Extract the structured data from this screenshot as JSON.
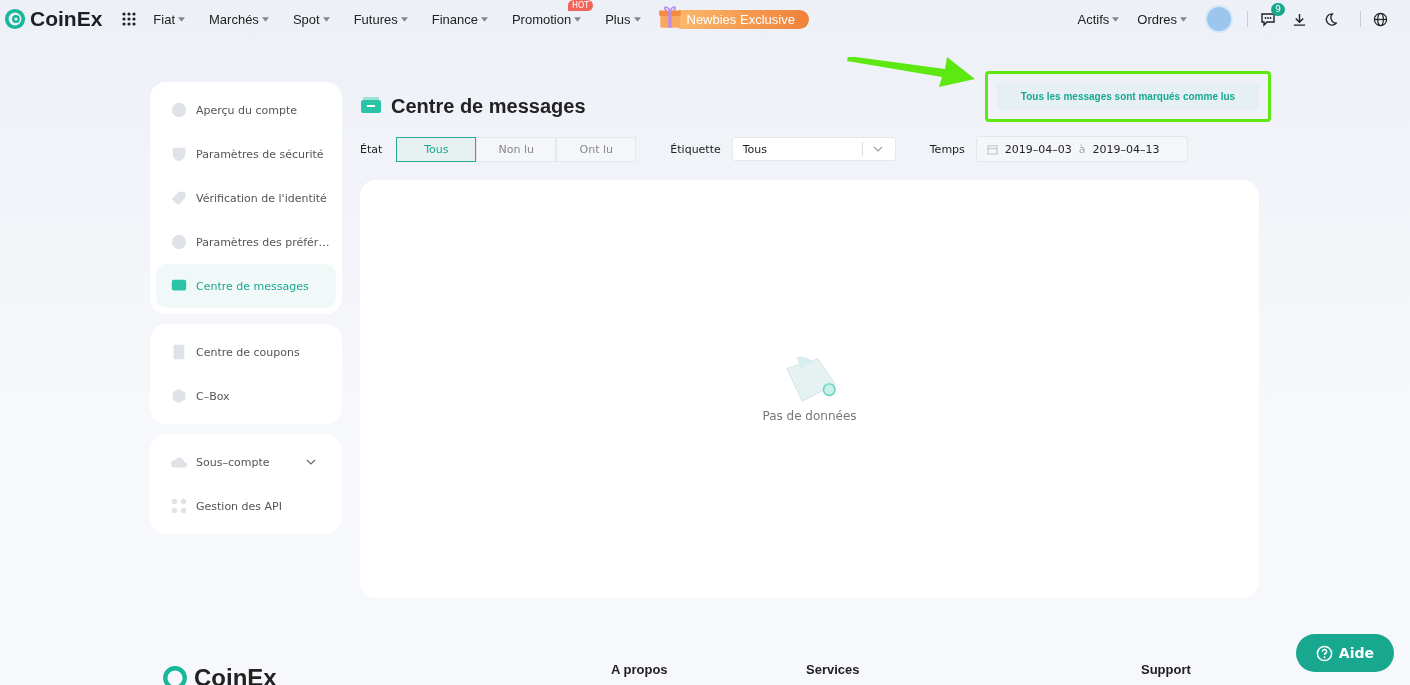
{
  "header": {
    "logo_text": "CoinEx",
    "nav": [
      {
        "label": "Fiat"
      },
      {
        "label": "Marchés"
      },
      {
        "label": "Spot"
      },
      {
        "label": "Futures"
      },
      {
        "label": "Finance"
      },
      {
        "label": "Promotion",
        "badge": "HOT"
      },
      {
        "label": "Plus"
      }
    ],
    "promo_button": "Newbies Exclusive",
    "nav_right": [
      {
        "label": "Actifs"
      },
      {
        "label": "Ordres"
      }
    ],
    "message_count": "9"
  },
  "sidebar": {
    "groups": [
      [
        {
          "label": "Aperçu du compte",
          "selected": false,
          "kind": "link"
        },
        {
          "label": "Paramètres de sécurité",
          "selected": false,
          "kind": "link"
        },
        {
          "label": "Vérification de l'identité",
          "selected": false,
          "kind": "link"
        },
        {
          "label": "Paramètres des préfér…",
          "selected": false,
          "kind": "link"
        },
        {
          "label": "Centre de messages",
          "selected": true,
          "kind": "link"
        }
      ],
      [
        {
          "label": "Centre de coupons",
          "selected": false,
          "kind": "link"
        },
        {
          "label": "C–Box",
          "selected": false,
          "kind": "link"
        }
      ],
      [
        {
          "label": "Sous–compte",
          "selected": false,
          "kind": "dropdown"
        },
        {
          "label": "Gestion des API",
          "selected": false,
          "kind": "link"
        }
      ]
    ]
  },
  "page": {
    "title": "Centre de messages",
    "mark_all_button": "Tous les messages sont marqués comme lus"
  },
  "filters": {
    "state_label": "État",
    "state_options": [
      {
        "label": "Tous",
        "selected": true
      },
      {
        "label": "Non lu",
        "selected": false
      },
      {
        "label": "Ont lu",
        "selected": false
      }
    ],
    "tag_label": "Étiquette",
    "tag_value": "Tous",
    "time_label": "Temps",
    "start_date": "2019–04–03",
    "separator": "à",
    "end_date": "2019–04–13"
  },
  "empty_state": {
    "text": "Pas de données"
  },
  "footer": {
    "logo_text": "CoinEx",
    "columns": [
      "A propos",
      "Services",
      "Support"
    ]
  },
  "help_button": "Aide"
}
